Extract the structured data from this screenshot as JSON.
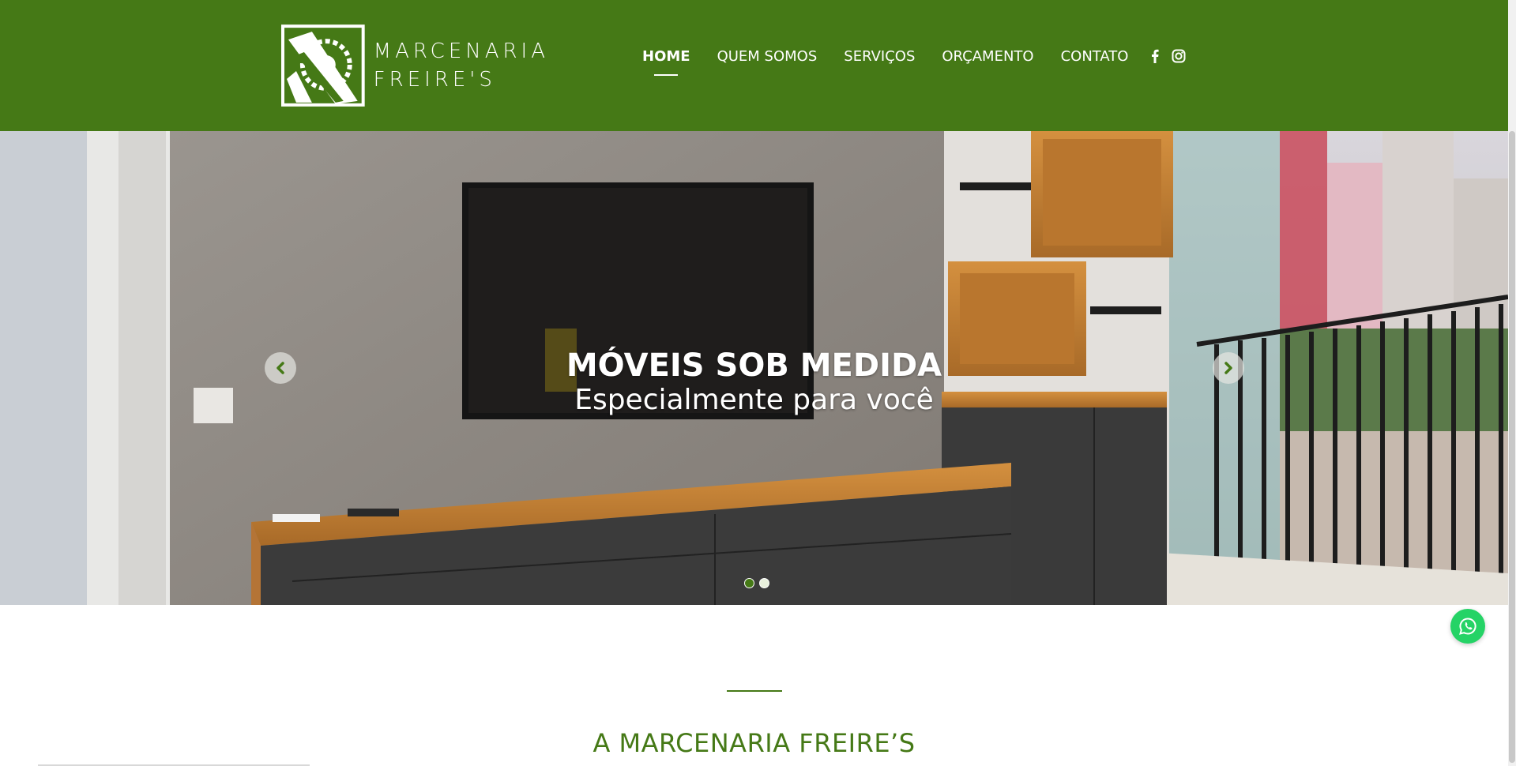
{
  "brand": {
    "line1": "MARCENARIA",
    "line2": "FREIRE'S"
  },
  "nav": {
    "items": [
      {
        "label": "HOME",
        "active": true
      },
      {
        "label": "QUEM SOMOS",
        "active": false
      },
      {
        "label": "SERVIÇOS",
        "active": false
      },
      {
        "label": "ORÇAMENTO",
        "active": false
      },
      {
        "label": "CONTATO",
        "active": false
      }
    ],
    "social": [
      "facebook-icon",
      "instagram-icon"
    ]
  },
  "hero": {
    "title": "MÓVEIS SOB MEDIDA",
    "subtitle": "Especialmente para você",
    "slides_total": 2,
    "active_slide": 1
  },
  "about": {
    "title": "A MARCENARIA FREIRE’S"
  },
  "colors": {
    "brand_green": "#457916",
    "whatsapp": "#25d366"
  }
}
